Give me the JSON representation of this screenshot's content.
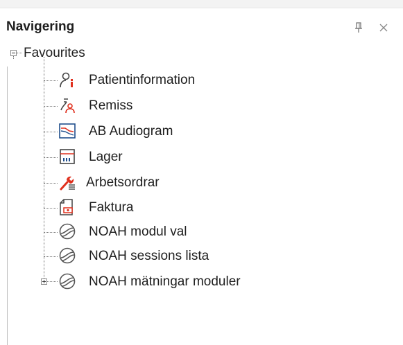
{
  "panel": {
    "title": "Navigering",
    "pin_icon": "pin-icon",
    "close_icon": "close-icon"
  },
  "tree": {
    "root": {
      "label": "Favourites",
      "expanded": true
    },
    "items": [
      {
        "label": "Patientinformation",
        "icon": "patient-info-icon"
      },
      {
        "label": "Remiss",
        "icon": "referral-icon"
      },
      {
        "label": "AB Audiogram",
        "icon": "audiogram-icon"
      },
      {
        "label": "Lager",
        "icon": "inventory-icon"
      },
      {
        "label": "Arbetsordrar",
        "icon": "work-order-icon"
      },
      {
        "label": "Faktura",
        "icon": "invoice-icon"
      },
      {
        "label": "NOAH modul val",
        "icon": "noah-icon"
      },
      {
        "label": "NOAH sessions lista",
        "icon": "noah-icon"
      },
      {
        "label": "NOAH mätningar moduler",
        "icon": "noah-icon",
        "expandable": true
      }
    ]
  },
  "colors": {
    "accent_red": "#e0301e",
    "icon_blue": "#1f4e8c",
    "icon_gray": "#555555"
  }
}
